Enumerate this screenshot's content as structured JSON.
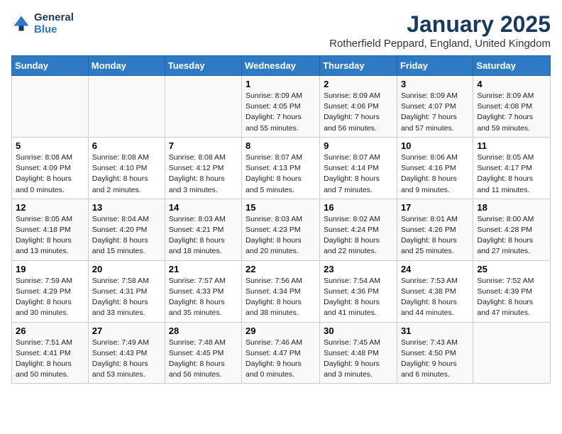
{
  "header": {
    "logo_line1": "General",
    "logo_line2": "Blue",
    "title": "January 2025",
    "subtitle": "Rotherfield Peppard, England, United Kingdom"
  },
  "columns": [
    "Sunday",
    "Monday",
    "Tuesday",
    "Wednesday",
    "Thursday",
    "Friday",
    "Saturday"
  ],
  "weeks": [
    [
      {
        "day": "",
        "info": ""
      },
      {
        "day": "",
        "info": ""
      },
      {
        "day": "",
        "info": ""
      },
      {
        "day": "1",
        "info": "Sunrise: 8:09 AM\nSunset: 4:05 PM\nDaylight: 7 hours\nand 55 minutes."
      },
      {
        "day": "2",
        "info": "Sunrise: 8:09 AM\nSunset: 4:06 PM\nDaylight: 7 hours\nand 56 minutes."
      },
      {
        "day": "3",
        "info": "Sunrise: 8:09 AM\nSunset: 4:07 PM\nDaylight: 7 hours\nand 57 minutes."
      },
      {
        "day": "4",
        "info": "Sunrise: 8:09 AM\nSunset: 4:08 PM\nDaylight: 7 hours\nand 59 minutes."
      }
    ],
    [
      {
        "day": "5",
        "info": "Sunrise: 8:08 AM\nSunset: 4:09 PM\nDaylight: 8 hours\nand 0 minutes."
      },
      {
        "day": "6",
        "info": "Sunrise: 8:08 AM\nSunset: 4:10 PM\nDaylight: 8 hours\nand 2 minutes."
      },
      {
        "day": "7",
        "info": "Sunrise: 8:08 AM\nSunset: 4:12 PM\nDaylight: 8 hours\nand 3 minutes."
      },
      {
        "day": "8",
        "info": "Sunrise: 8:07 AM\nSunset: 4:13 PM\nDaylight: 8 hours\nand 5 minutes."
      },
      {
        "day": "9",
        "info": "Sunrise: 8:07 AM\nSunset: 4:14 PM\nDaylight: 8 hours\nand 7 minutes."
      },
      {
        "day": "10",
        "info": "Sunrise: 8:06 AM\nSunset: 4:16 PM\nDaylight: 8 hours\nand 9 minutes."
      },
      {
        "day": "11",
        "info": "Sunrise: 8:05 AM\nSunset: 4:17 PM\nDaylight: 8 hours\nand 11 minutes."
      }
    ],
    [
      {
        "day": "12",
        "info": "Sunrise: 8:05 AM\nSunset: 4:18 PM\nDaylight: 8 hours\nand 13 minutes."
      },
      {
        "day": "13",
        "info": "Sunrise: 8:04 AM\nSunset: 4:20 PM\nDaylight: 8 hours\nand 15 minutes."
      },
      {
        "day": "14",
        "info": "Sunrise: 8:03 AM\nSunset: 4:21 PM\nDaylight: 8 hours\nand 18 minutes."
      },
      {
        "day": "15",
        "info": "Sunrise: 8:03 AM\nSunset: 4:23 PM\nDaylight: 8 hours\nand 20 minutes."
      },
      {
        "day": "16",
        "info": "Sunrise: 8:02 AM\nSunset: 4:24 PM\nDaylight: 8 hours\nand 22 minutes."
      },
      {
        "day": "17",
        "info": "Sunrise: 8:01 AM\nSunset: 4:26 PM\nDaylight: 8 hours\nand 25 minutes."
      },
      {
        "day": "18",
        "info": "Sunrise: 8:00 AM\nSunset: 4:28 PM\nDaylight: 8 hours\nand 27 minutes."
      }
    ],
    [
      {
        "day": "19",
        "info": "Sunrise: 7:59 AM\nSunset: 4:29 PM\nDaylight: 8 hours\nand 30 minutes."
      },
      {
        "day": "20",
        "info": "Sunrise: 7:58 AM\nSunset: 4:31 PM\nDaylight: 8 hours\nand 33 minutes."
      },
      {
        "day": "21",
        "info": "Sunrise: 7:57 AM\nSunset: 4:33 PM\nDaylight: 8 hours\nand 35 minutes."
      },
      {
        "day": "22",
        "info": "Sunrise: 7:56 AM\nSunset: 4:34 PM\nDaylight: 8 hours\nand 38 minutes."
      },
      {
        "day": "23",
        "info": "Sunrise: 7:54 AM\nSunset: 4:36 PM\nDaylight: 8 hours\nand 41 minutes."
      },
      {
        "day": "24",
        "info": "Sunrise: 7:53 AM\nSunset: 4:38 PM\nDaylight: 8 hours\nand 44 minutes."
      },
      {
        "day": "25",
        "info": "Sunrise: 7:52 AM\nSunset: 4:39 PM\nDaylight: 8 hours\nand 47 minutes."
      }
    ],
    [
      {
        "day": "26",
        "info": "Sunrise: 7:51 AM\nSunset: 4:41 PM\nDaylight: 8 hours\nand 50 minutes."
      },
      {
        "day": "27",
        "info": "Sunrise: 7:49 AM\nSunset: 4:43 PM\nDaylight: 8 hours\nand 53 minutes."
      },
      {
        "day": "28",
        "info": "Sunrise: 7:48 AM\nSunset: 4:45 PM\nDaylight: 8 hours\nand 56 minutes."
      },
      {
        "day": "29",
        "info": "Sunrise: 7:46 AM\nSunset: 4:47 PM\nDaylight: 9 hours\nand 0 minutes."
      },
      {
        "day": "30",
        "info": "Sunrise: 7:45 AM\nSunset: 4:48 PM\nDaylight: 9 hours\nand 3 minutes."
      },
      {
        "day": "31",
        "info": "Sunrise: 7:43 AM\nSunset: 4:50 PM\nDaylight: 9 hours\nand 6 minutes."
      },
      {
        "day": "",
        "info": ""
      }
    ]
  ]
}
